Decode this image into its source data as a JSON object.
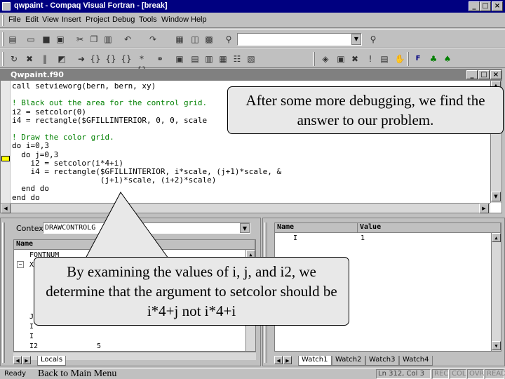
{
  "window": {
    "title": "qwpaint - Compaq Visual Fortran - [break]",
    "controls": [
      "_",
      "□",
      "×"
    ]
  },
  "menu": [
    "File",
    "Edit",
    "View",
    "Insert",
    "Project",
    "Debug",
    "Tools",
    "Window",
    "Help"
  ],
  "editor": {
    "title": "Qwpaint.f90",
    "code_lines": [
      {
        "text": "call setvieworg(bern, bern, xy)",
        "type": "code"
      },
      {
        "text": "",
        "type": "code"
      },
      {
        "text": "! Black out the area for the control grid.",
        "type": "comment"
      },
      {
        "text": "i2 = setcolor(0)",
        "type": "code"
      },
      {
        "text": "i4 = rectangle($GFILLINTERIOR, 0, 0, scale",
        "type": "code"
      },
      {
        "text": "",
        "type": "code"
      },
      {
        "text": "! Draw the color grid.",
        "type": "comment"
      },
      {
        "text": "do i=0,3",
        "type": "code"
      },
      {
        "text": "  do j=0,3",
        "type": "code"
      },
      {
        "text": "    i2 = setcolor(i*4+i)",
        "type": "code"
      },
      {
        "text": "    i4 = rectangle($GFILLINTERIOR, i*scale, (j+1)*scale, &",
        "type": "code"
      },
      {
        "text": "                   (j+1)*scale, (i+2)*scale)",
        "type": "code"
      },
      {
        "text": "  end do",
        "type": "code"
      },
      {
        "text": "end do",
        "type": "code"
      }
    ]
  },
  "locals_pane": {
    "context_label": "Context:",
    "context_value": "DRAWCONTROLG",
    "column_name": "Name",
    "rows": [
      {
        "name": "FONTNUM",
        "value": ""
      },
      {
        "name": "XY",
        "value": ""
      },
      {
        "name": "J",
        "value": ""
      },
      {
        "name": "I",
        "value": ""
      },
      {
        "name": "I",
        "value": ""
      },
      {
        "name": "I2",
        "value": "5"
      }
    ],
    "tabs": [
      "Locals"
    ]
  },
  "watch_pane": {
    "col_name": "Name",
    "col_value": "Value",
    "rows": [
      {
        "name": "I",
        "value": "1"
      }
    ],
    "tabs": [
      "Watch1",
      "Watch2",
      "Watch3",
      "Watch4"
    ]
  },
  "statusbar": {
    "ready": "Ready",
    "back_link": "Back to Main Menu",
    "position": "Ln 312, Col 3",
    "indicators": [
      "REC",
      "COL",
      "OVR",
      "READ"
    ]
  },
  "callouts": {
    "top": "After some more debugging, we find the answer to our problem.",
    "bottom": "By examining the values of i, j, and i2, we determine that the argument to setcolor should be i*4+j not i*4+i"
  },
  "colors": {
    "titlebar": "#000080",
    "editor_titlebar": "#808080",
    "comment": "#008000",
    "callout_fill": "#e8e8e8",
    "exec_arrow": "#ffff00"
  }
}
